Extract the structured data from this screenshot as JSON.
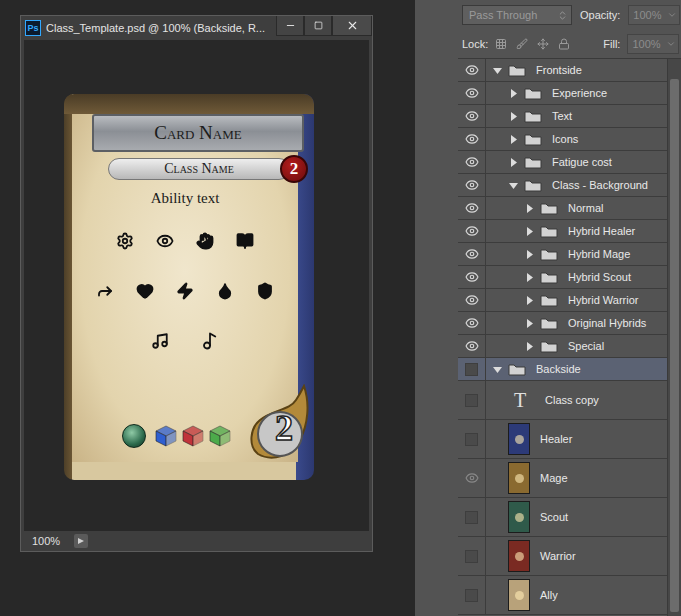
{
  "window": {
    "title": "Class_Template.psd @ 100% (Backside, R...",
    "app_icon": "Ps"
  },
  "card": {
    "name": "Card Name",
    "class_name": "Class Name",
    "cost": "2",
    "ability": "Ability text",
    "fatigue": "2",
    "token_color": "#2c6a4c",
    "dice": [
      {
        "color": "#2f5fd0"
      },
      {
        "color": "#c0333a"
      },
      {
        "color": "#4caa4a"
      }
    ]
  },
  "status_bar": {
    "zoom": "100%"
  },
  "layers_panel": {
    "blend_mode": "Pass Through",
    "opacity_label": "Opacity:",
    "opacity": "100%",
    "lock_label": "Lock:",
    "fill_label": "Fill:",
    "fill": "100%",
    "fields_disabled": true,
    "layers": [
      {
        "name": "Frontside",
        "kind": "group",
        "depth": 0,
        "expanded": true,
        "visible": true,
        "selected": false
      },
      {
        "name": "Experience",
        "kind": "group",
        "depth": 1,
        "expanded": false,
        "visible": true,
        "selected": false
      },
      {
        "name": "Text",
        "kind": "group",
        "depth": 1,
        "expanded": false,
        "visible": true,
        "selected": false
      },
      {
        "name": "Icons",
        "kind": "group",
        "depth": 1,
        "expanded": false,
        "visible": true,
        "selected": false
      },
      {
        "name": "Fatigue cost",
        "kind": "group",
        "depth": 1,
        "expanded": false,
        "visible": true,
        "selected": false
      },
      {
        "name": "Class - Background",
        "kind": "group",
        "depth": 1,
        "expanded": true,
        "visible": true,
        "selected": false
      },
      {
        "name": "Normal",
        "kind": "group",
        "depth": 2,
        "expanded": false,
        "visible": true,
        "selected": false
      },
      {
        "name": "Hybrid Healer",
        "kind": "group",
        "depth": 2,
        "expanded": false,
        "visible": true,
        "selected": false
      },
      {
        "name": "Hybrid Mage",
        "kind": "group",
        "depth": 2,
        "expanded": false,
        "visible": true,
        "selected": false
      },
      {
        "name": "Hybrid Scout",
        "kind": "group",
        "depth": 2,
        "expanded": false,
        "visible": true,
        "selected": false
      },
      {
        "name": "Hybrid Warrior",
        "kind": "group",
        "depth": 2,
        "expanded": false,
        "visible": true,
        "selected": false
      },
      {
        "name": "Original Hybrids",
        "kind": "group",
        "depth": 2,
        "expanded": false,
        "visible": true,
        "selected": false
      },
      {
        "name": "Special",
        "kind": "group",
        "depth": 2,
        "expanded": false,
        "visible": true,
        "selected": false
      },
      {
        "name": "Backside",
        "kind": "group",
        "depth": 0,
        "expanded": true,
        "visible": false,
        "selected": true
      },
      {
        "name": "Class copy",
        "kind": "text",
        "glyph": "T",
        "depth": 1,
        "visible": false,
        "selected": false
      },
      {
        "name": "Healer",
        "kind": "image",
        "depth": 1,
        "visible": false,
        "selected": false,
        "color": "#2c3a78"
      },
      {
        "name": "Mage",
        "kind": "image",
        "depth": 1,
        "visible": true,
        "selected": false,
        "color": "#8a6a30"
      },
      {
        "name": "Scout",
        "kind": "image",
        "depth": 1,
        "visible": false,
        "selected": false,
        "color": "#2f5a4a"
      },
      {
        "name": "Warrior",
        "kind": "image",
        "depth": 1,
        "visible": false,
        "selected": false,
        "color": "#7a2a22"
      },
      {
        "name": "Ally",
        "kind": "image",
        "depth": 1,
        "visible": false,
        "selected": false,
        "color": "#b8a27a"
      }
    ]
  }
}
